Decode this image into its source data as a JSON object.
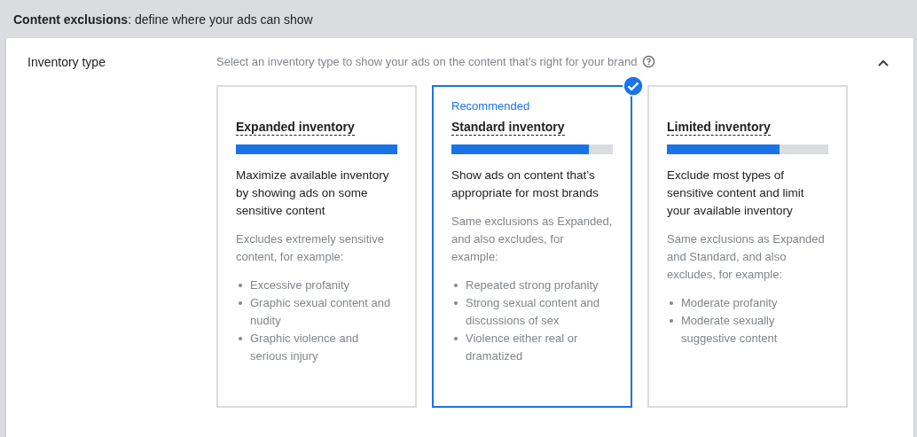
{
  "header": {
    "title_bold": "Content exclusions",
    "title_rest": ": define where your ads can show"
  },
  "section": {
    "label": "Inventory type",
    "description": "Select an inventory type to show your ads on the content that's right for your brand",
    "expanded": true,
    "cards": [
      {
        "title": "Expanded inventory",
        "level": 1.0,
        "summary": "Maximize available inventory by showing ads on some sensitive content",
        "note": "Excludes extremely sensitive content, for example:",
        "examples": [
          "Excessive profanity",
          "Graphic sexual content and nudity",
          "Graphic violence and serious injury"
        ],
        "selected": false
      },
      {
        "badge": "Recommended",
        "title": "Standard inventory",
        "level": 0.85,
        "summary": "Show ads on content that’s appropriate for most brands",
        "note": "Same exclusions as Expanded, and also excludes, for example:",
        "examples": [
          "Repeated strong profanity",
          "Strong sexual content and discussions of sex",
          "Violence either real or dramatized"
        ],
        "selected": true
      },
      {
        "title": "Limited inventory",
        "level": 0.7,
        "summary": "Exclude most types of sensitive content and limit your available inventory",
        "note": "Same exclusions as Expanded and Standard, and also excludes, for example:",
        "examples": [
          "Moderate profanity",
          "Moderate sexually suggestive content"
        ],
        "selected": false
      }
    ]
  }
}
